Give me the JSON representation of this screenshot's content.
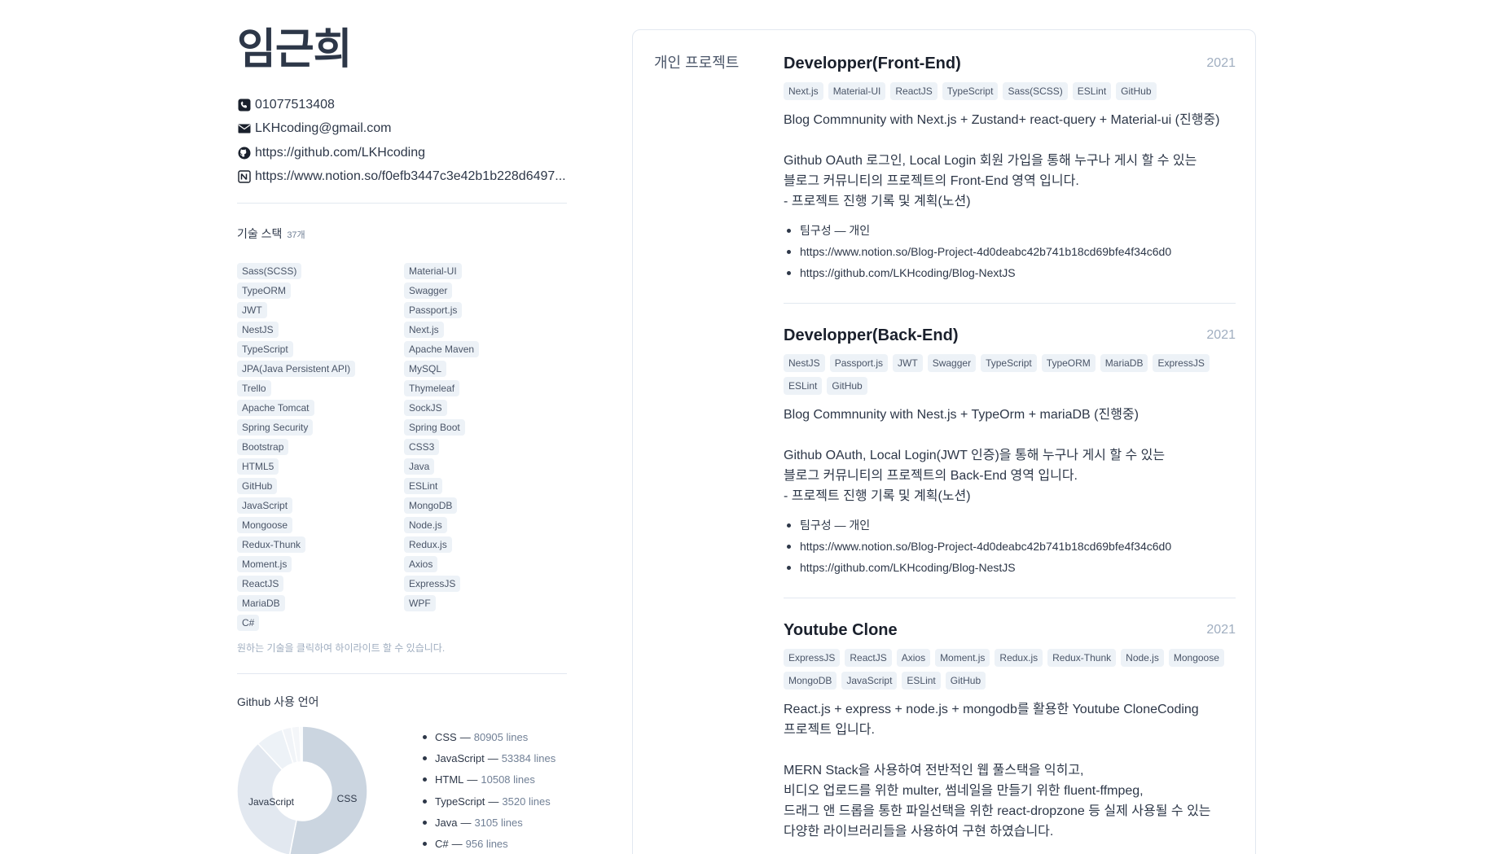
{
  "profile": {
    "name": "임근희",
    "phone": "01077513408",
    "email": "LKHcoding@gmail.com",
    "github": "https://github.com/LKHcoding",
    "notion": "https://www.notion.so/f0efb3447c3e42b1b228d6497..."
  },
  "skills": {
    "title": "기술 스택",
    "count": "37개",
    "items": [
      "Sass(SCSS)",
      "Material-UI",
      "TypeORM",
      "Swagger",
      "JWT",
      "Passport.js",
      "NestJS",
      "Next.js",
      "TypeScript",
      "Apache Maven",
      "JPA(Java Persistent API)",
      "MySQL",
      "Trello",
      "Thymeleaf",
      "Apache Tomcat",
      "SockJS",
      "Spring Security",
      "Spring Boot",
      "Bootstrap",
      "CSS3",
      "HTML5",
      "Java",
      "GitHub",
      "ESLint",
      "JavaScript",
      "MongoDB",
      "Mongoose",
      "Node.js",
      "Redux-Thunk",
      "Redux.js",
      "Moment.js",
      "Axios",
      "ReactJS",
      "ExpressJS",
      "MariaDB",
      "WPF",
      "C#"
    ],
    "hint": "원하는 기술을 클릭하여 하이라이트 할 수 있습니다."
  },
  "github_langs": {
    "title": "Github 사용 언어",
    "sep": "—",
    "languages": [
      {
        "name": "CSS",
        "lines": "80905 lines"
      },
      {
        "name": "JavaScript",
        "lines": "53384 lines"
      },
      {
        "name": "HTML",
        "lines": "10508 lines"
      },
      {
        "name": "TypeScript",
        "lines": "3520 lines"
      },
      {
        "name": "Java",
        "lines": "3105 lines"
      },
      {
        "name": "C#",
        "lines": "956 lines"
      }
    ],
    "chart_labels": {
      "css": "CSS",
      "javascript": "JavaScript"
    },
    "colors": [
      "#cbd5e0",
      "#e2e8f0",
      "#edf2f7",
      "#f1f4f8",
      "#f4f6f9",
      "#f7f9fb"
    ]
  },
  "chart_data": {
    "type": "pie",
    "categories": [
      "CSS",
      "JavaScript",
      "HTML",
      "TypeScript",
      "Java",
      "C#"
    ],
    "values": [
      80905,
      53384,
      10508,
      3520,
      3105,
      956
    ]
  },
  "section_label": "개인 프로젝트",
  "projects": [
    {
      "title": "Developper(Front-End)",
      "year": "2021",
      "tags": [
        "Next.js",
        "Material-UI",
        "ReactJS",
        "TypeScript",
        "Sass(SCSS)",
        "ESLint",
        "GitHub"
      ],
      "desc": "Blog Commnunity with Next.js + Zustand+ react-query + Material-ui (진행중)\n\nGithub OAuth 로그인, Local Login 회원 가입을 통해 누구나 게시 할 수 있는\n블로그 커뮤니티의 프로젝트의 Front-End 영역 입니다.\n- 프로젝트 진행 기록 및 계획(노션)",
      "bullets": [
        "팀구성 — 개인",
        "https://www.notion.so/Blog-Project-4d0deabc42b741b18cd69bfe4f34c6d0",
        "https://github.com/LKHcoding/Blog-NextJS"
      ]
    },
    {
      "title": "Developper(Back-End)",
      "year": "2021",
      "tags": [
        "NestJS",
        "Passport.js",
        "JWT",
        "Swagger",
        "TypeScript",
        "TypeORM",
        "MariaDB",
        "ExpressJS",
        "ESLint",
        "GitHub"
      ],
      "desc": "Blog Commnunity with Nest.js + TypeOrm + mariaDB (진행중)\n\nGithub OAuth, Local Login(JWT 인증)을 통해 누구나 게시 할 수 있는\n블로그 커뮤니티의 프로젝트의 Back-End 영역 입니다.\n- 프로젝트 진행 기록 및 계획(노션)",
      "bullets": [
        "팀구성 — 개인",
        "https://www.notion.so/Blog-Project-4d0deabc42b741b18cd69bfe4f34c6d0",
        "https://github.com/LKHcoding/Blog-NestJS"
      ]
    },
    {
      "title": "Youtube Clone",
      "year": "2021",
      "tags": [
        "ExpressJS",
        "ReactJS",
        "Axios",
        "Moment.js",
        "Redux.js",
        "Redux-Thunk",
        "Node.js",
        "Mongoose",
        "MongoDB",
        "JavaScript",
        "ESLint",
        "GitHub"
      ],
      "desc": "React.js + express + node.js + mongodb를 활용한 Youtube CloneCoding\n프로젝트 입니다.\n\nMERN Stack을 사용하여 전반적인 웹 풀스택을 익히고,\n비디오 업로드를 위한 multer, 썸네일을 만들기 위한 fluent-ffmpeg,\n드래그 앤 드롭을 통한 파일선택을 위한 react-dropzone 등 실제 사용될 수 있는\n다양한 라이브러리들을 사용하여 구현 하였습니다.",
      "bullets": []
    }
  ]
}
